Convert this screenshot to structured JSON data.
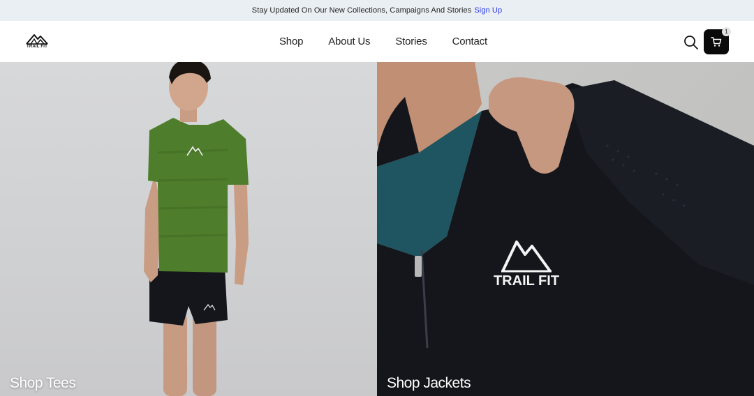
{
  "announcement": {
    "text": "Stay Updated On Our New Collections, Campaigns And Stories",
    "link": "Sign Up"
  },
  "header": {
    "logo_text": "TRAIL FIT",
    "nav": [
      "Shop",
      "About Us",
      "Stories",
      "Contact"
    ],
    "cart_count": "1",
    "icons": {
      "search": "search-icon",
      "cart": "cart-icon"
    }
  },
  "panels": [
    {
      "label": "Shop Tees",
      "image": "model-green-tee-photo"
    },
    {
      "label": "Shop Jackets",
      "image": "black-jacket-closeup-photo"
    }
  ],
  "colors": {
    "announcement_bg": "#eaeff3",
    "link": "#2a3ae8",
    "cart_bg": "#0a0a0a",
    "tee_green": "#4e7d2c",
    "jacket_black": "#14161c"
  }
}
